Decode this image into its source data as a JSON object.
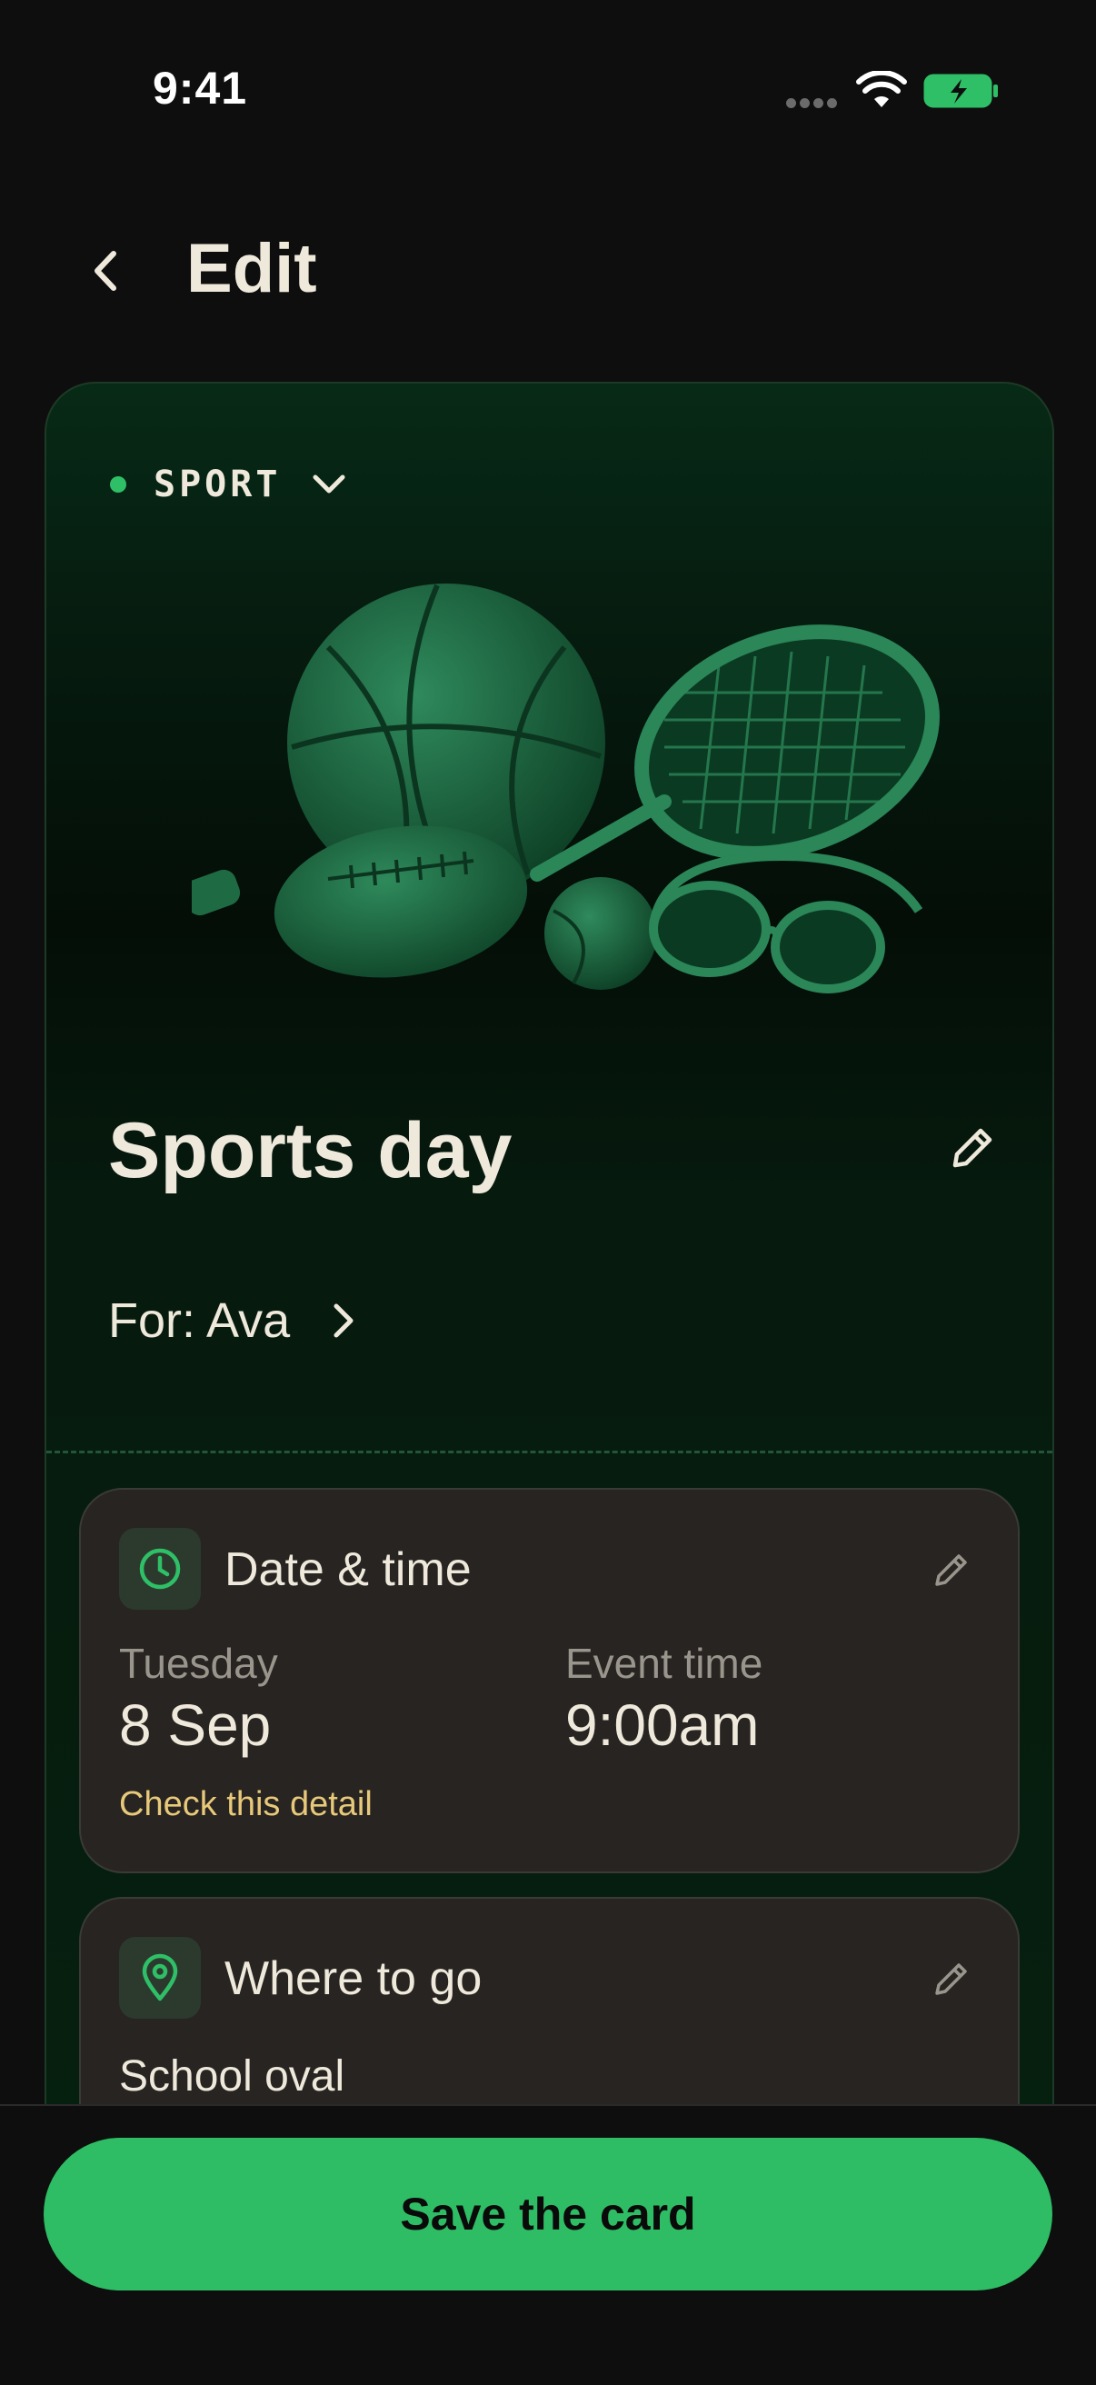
{
  "status_bar": {
    "time": "9:41"
  },
  "header": {
    "title": "Edit"
  },
  "event": {
    "category": "SPORT",
    "title": "Sports day",
    "for_label": "For: Ava"
  },
  "date_time": {
    "heading": "Date & time",
    "day_label": "Tuesday",
    "date_value": "8 Sep",
    "time_label": "Event time",
    "time_value": "9:00am",
    "warning": "Check this detail"
  },
  "location": {
    "heading": "Where to go",
    "value": "School oval"
  },
  "actions": {
    "save_label": "Save the card"
  },
  "colors": {
    "accent": "#2ebd64",
    "background": "#0e0e0e",
    "card_green": "#072a16",
    "detail_card": "#272421",
    "warning": "#e8c97a"
  },
  "icons": [
    "back-arrow-icon",
    "wifi-icon",
    "battery-charging-icon",
    "chevron-down-icon",
    "pencil-icon",
    "chevron-right-icon",
    "clock-icon",
    "location-pin-icon"
  ]
}
